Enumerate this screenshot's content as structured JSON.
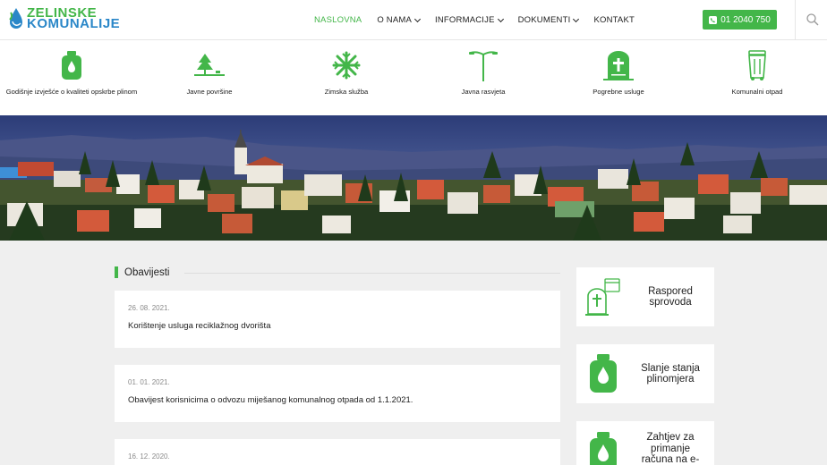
{
  "logo": {
    "line1": "ZELINSKE",
    "line2": "KOMUNALIJE"
  },
  "nav": [
    {
      "label": "NASLOVNA",
      "active": true,
      "dropdown": false
    },
    {
      "label": "O NAMA",
      "active": false,
      "dropdown": true
    },
    {
      "label": "INFORMACIJE",
      "active": false,
      "dropdown": true
    },
    {
      "label": "DOKUMENTI",
      "active": false,
      "dropdown": true
    },
    {
      "label": "KONTAKT",
      "active": false,
      "dropdown": false
    }
  ],
  "phone": "01 2040 750",
  "services": [
    {
      "label": "Godišnje izvješće o kvaliteti opskrbe plinom",
      "icon": "gas-cylinder-icon"
    },
    {
      "label": "Javne površine",
      "icon": "tree-icon"
    },
    {
      "label": "Zimska služba",
      "icon": "snowflake-icon"
    },
    {
      "label": "Javna rasvjeta",
      "icon": "street-lamp-icon"
    },
    {
      "label": "Pogrebne usluge",
      "icon": "gravestone-icon"
    },
    {
      "label": "Komunalni otpad",
      "icon": "trash-bin-icon"
    }
  ],
  "section_title": "Obavijesti",
  "news": [
    {
      "date": "26. 08. 2021.",
      "text": "Korištenje usluga reciklažnog dvorišta"
    },
    {
      "date": "01. 01. 2021.",
      "text": "Obavijest korisnicima o odvozu miješanog komunalnog otpada od 1.1.2021."
    },
    {
      "date": "16. 12. 2020.",
      "text": ""
    }
  ],
  "sidebar": [
    {
      "line1": "Raspored",
      "line2": "sprovoda",
      "line3": "",
      "line4": "",
      "icon": "funeral-schedule-icon"
    },
    {
      "line1": "Slanje stanja",
      "line2": "plinomjera",
      "line3": "",
      "line4": "",
      "icon": "gas-cylinder-icon"
    },
    {
      "line1": "Zahtjev za",
      "line2": "primanje",
      "line3": "računa na e-",
      "line4": "",
      "icon": "gas-cylinder-icon"
    }
  ],
  "colors": {
    "accent": "#43b649",
    "logo_blue": "#2a87c8",
    "background": "#efefef"
  }
}
